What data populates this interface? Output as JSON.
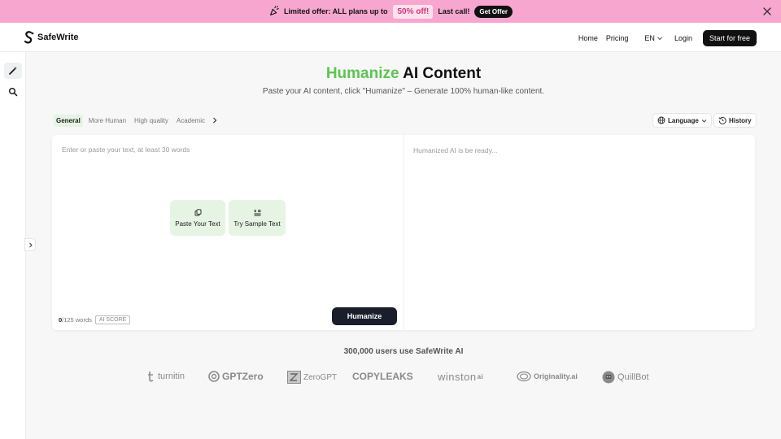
{
  "promo": {
    "text": "Limited offer: ALL plans up to",
    "badge": "50% off!",
    "last_call": "Last call!",
    "cta": "Get Offer"
  },
  "nav": {
    "brand": "SafeWrite",
    "links": [
      "Home",
      "Pricing"
    ],
    "language": "EN",
    "login": "Login",
    "cta": "Start for free"
  },
  "hero": {
    "title_accent": "Humanize",
    "title_rest": "AI Content",
    "subtitle": "Paste your AI content, click \"Humanize\" – Generate 100% human-like content."
  },
  "modes": {
    "tabs": [
      "General",
      "More Human",
      "High quality",
      "Academic"
    ],
    "active": "General"
  },
  "toolbar": {
    "language_label": "Language",
    "history_label": "History"
  },
  "editor": {
    "input_placeholder": "Enter or paste your text, at least 30 words",
    "output_placeholder": "Humanized AI is be ready...",
    "paste_label": "Paste Your Text",
    "sample_label": "Try Sample Text",
    "word_count": "0",
    "word_limit": "/125 words",
    "ai_score": "AI SCORE",
    "humanize_label": "Humanize"
  },
  "social_proof": {
    "text": "300,000 users use SafeWrite AI",
    "brands": [
      "turnitin",
      "GPTZero",
      "ZeroGPT",
      "COPYLEAKS",
      "winston",
      "Originality.ai",
      "QuillBot"
    ]
  },
  "colors": {
    "accent_green": "#5ec550",
    "promo_pink": "#f7a6cf",
    "dark": "#1a1d2b"
  }
}
